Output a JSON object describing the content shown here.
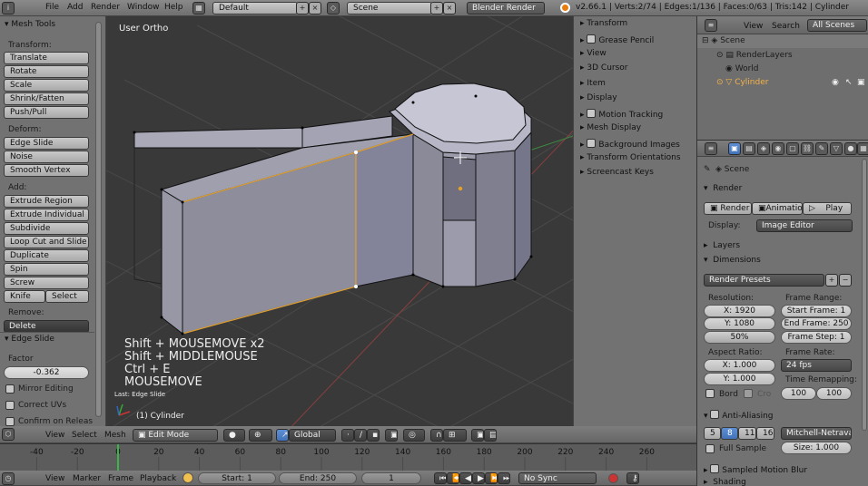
{
  "topbar": {
    "menus": [
      "File",
      "Add",
      "Render",
      "Window",
      "Help"
    ],
    "layout": "Default",
    "scene": "Scene",
    "engine": "Blender Render",
    "stats": "v2.66.1 | Verts:2/74 | Edges:1/136 | Faces:0/63 | Tris:142 | Cylinder"
  },
  "toolshelf": {
    "title": "Mesh Tools",
    "transform_label": "Transform:",
    "transform": [
      "Translate",
      "Rotate",
      "Scale",
      "Shrink/Fatten",
      "Push/Pull"
    ],
    "deform_label": "Deform:",
    "deform": [
      "Edge Slide",
      "Noise",
      "Smooth Vertex"
    ],
    "add_label": "Add:",
    "add": [
      "Extrude Region",
      "Extrude Individual",
      "Subdivide",
      "Loop Cut and Slide",
      "Duplicate",
      "Spin",
      "Screw"
    ],
    "knife": "Knife",
    "select": "Select",
    "remove_label": "Remove:",
    "delete": "Delete",
    "op_title": "Edge Slide",
    "factor_label": "Factor",
    "factor_value": "-0.362",
    "mirror": "Mirror Editing",
    "correct_uvs": "Correct UVs",
    "confirm": "Confirm on Releas"
  },
  "viewport": {
    "view_name": "User Ortho",
    "keys": [
      "Shift + MOUSEMOVE x2",
      "Shift + MIDDLEMOUSE",
      "Ctrl + E",
      "MOUSEMOVE"
    ],
    "last_op": "Last: Edge Slide",
    "object_label": "(1) Cylinder"
  },
  "npanel": {
    "items": [
      {
        "label": "Transform",
        "check": false
      },
      {
        "label": "Grease Pencil",
        "check": true
      },
      {
        "label": "View",
        "check": false
      },
      {
        "label": "3D Cursor",
        "check": false
      },
      {
        "label": "Item",
        "check": false
      },
      {
        "label": "Display",
        "check": false
      },
      {
        "label": "Motion Tracking",
        "check": true
      },
      {
        "label": "Mesh Display",
        "check": false
      },
      {
        "label": "Background Images",
        "check": true
      },
      {
        "label": "Transform Orientations",
        "check": false
      },
      {
        "label": "Screencast Keys",
        "check": false
      }
    ]
  },
  "outliner": {
    "view": "View",
    "search": "Search",
    "filter": "All Scenes",
    "tree": [
      "Scene",
      "RenderLayers",
      "World",
      "Cylinder"
    ]
  },
  "properties": {
    "context": "Scene",
    "render_title": "Render",
    "render_btn": "Render",
    "animation_btn": "Animation",
    "play_btn": "Play",
    "display_label": "Display:",
    "display_value": "Image Editor",
    "layers": "Layers",
    "dimensions": "Dimensions",
    "presets": "Render Presets",
    "resolution_label": "Resolution:",
    "res_x": "X: 1920",
    "res_y": "Y: 1080",
    "res_pct": "50%",
    "frame_range_label": "Frame Range:",
    "start_frame": "Start Frame: 1",
    "end_frame": "End Frame: 250",
    "frame_step": "Frame Step: 1",
    "aspect_label": "Aspect Ratio:",
    "asp_x": "X: 1.000",
    "asp_y": "Y: 1.000",
    "frame_rate_label": "Frame Rate:",
    "fps": "24 fps",
    "time_remap_label": "Time Remapping:",
    "remap_old": "100",
    "remap_new": "100",
    "bord": "Bord",
    "cro": "Cro",
    "aa_title": "Anti-Aliasing",
    "aa_samples": [
      "5",
      "8",
      "11",
      "16"
    ],
    "aa_filter": "Mitchell-Netrava",
    "full_sample": "Full Sample",
    "size": "Size: 1.000",
    "motion_blur": "Sampled Motion Blur",
    "shading": "Shading"
  },
  "view_header": {
    "menus": [
      "View",
      "Select",
      "Mesh"
    ],
    "mode": "Edit Mode",
    "orientation": "Global"
  },
  "timeline": {
    "ticks": [
      "-40",
      "-20",
      "0",
      "20",
      "40",
      "60",
      "80",
      "100",
      "120",
      "140",
      "160",
      "180",
      "200",
      "220",
      "240",
      "260"
    ],
    "current": 0
  },
  "timeline_header": {
    "menus": [
      "View",
      "Marker",
      "Frame",
      "Playback"
    ],
    "start": "Start: 1",
    "end": "End: 250",
    "frame": "1",
    "sync": "No Sync"
  }
}
